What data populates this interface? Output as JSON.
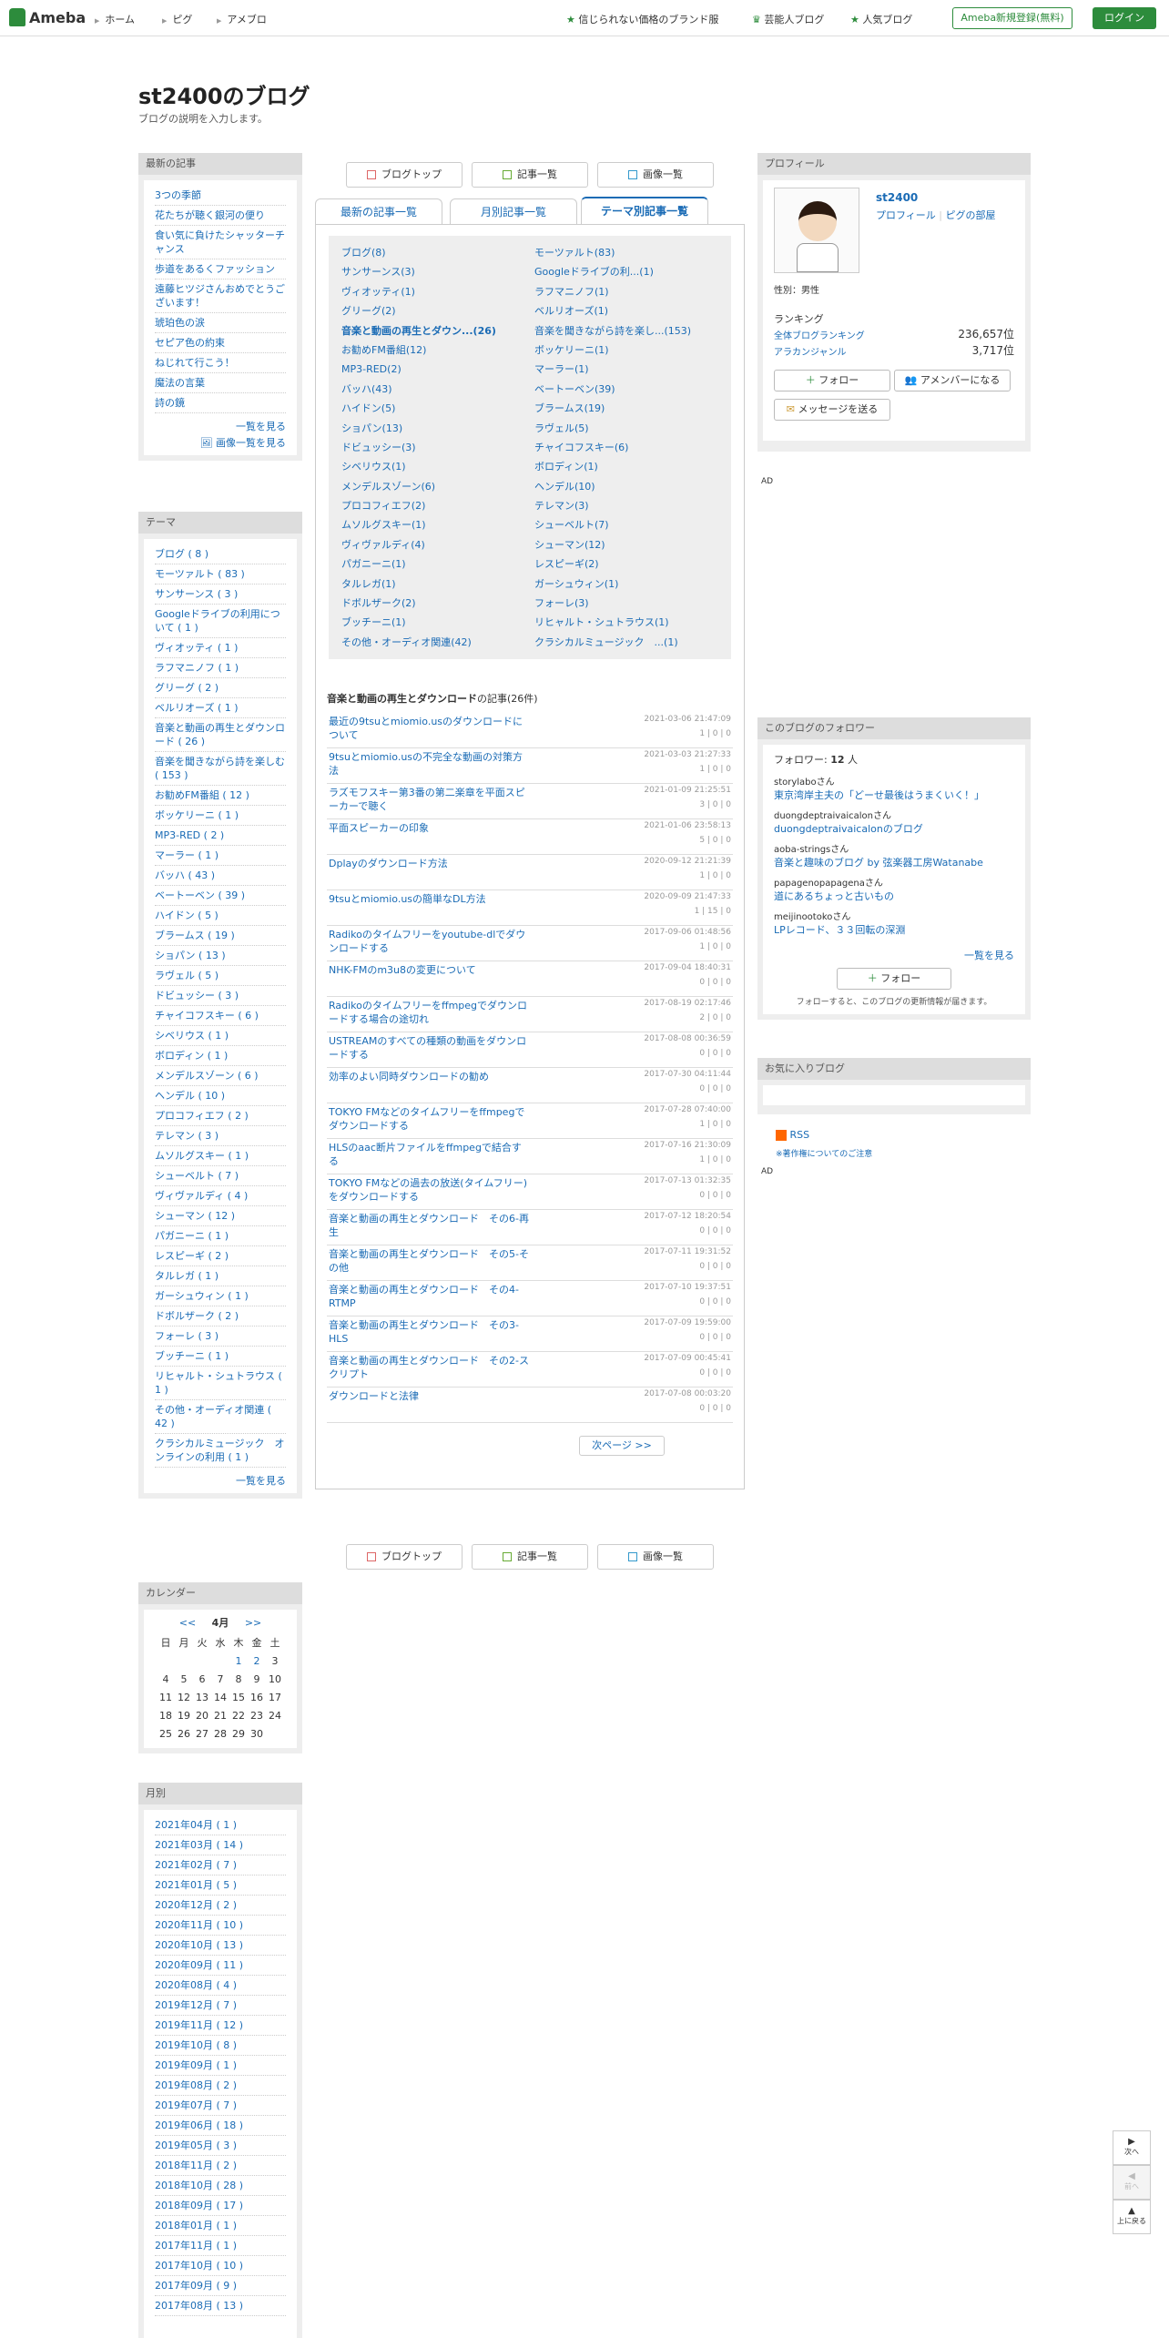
{
  "header": {
    "logo": "Ameba",
    "nav": [
      "ホーム",
      "ピグ",
      "アメブロ"
    ],
    "right_links": [
      "信じられない価格のブランド服",
      "芸能人ブログ",
      "人気ブログ"
    ],
    "register": "Ameba新規登録(無料)",
    "login": "ログイン"
  },
  "blog": {
    "title": "st2400のブログ",
    "description": "ブログの説明を入力します。"
  },
  "recent": {
    "heading": "最新の記事",
    "items": [
      "3つの季節",
      "花たちが聴く銀河の便り",
      "食い気に負けたシャッターチャンス",
      "歩道をあるくファッション",
      "遠藤ヒツジさんおめでとうございます！",
      "琥珀色の涙",
      "セピア色の約束",
      "ねじれて行こう！",
      "魔法の言葉",
      "詩の鏡"
    ],
    "more1": "一覧を見る",
    "more2": "画像一覧を見る"
  },
  "theme_side": {
    "heading": "テーマ",
    "items": [
      "ブログ ( 8 )",
      "モーツァルト ( 83 )",
      "サンサーンス ( 3 )",
      "Googleドライブの利用について ( 1 )",
      "ヴィオッティ ( 1 )",
      "ラフマニノフ ( 1 )",
      "グリーグ ( 2 )",
      "ベルリオーズ ( 1 )",
      "音楽と動画の再生とダウンロード ( 26 )",
      "音楽を聞きながら詩を楽しむ ( 153 )",
      "お勧めFM番組 ( 12 )",
      "ボッケリーニ ( 1 )",
      "MP3-RED ( 2 )",
      "マーラー ( 1 )",
      "バッハ ( 43 )",
      "ベートーベン ( 39 )",
      "ハイドン ( 5 )",
      "ブラームス ( 19 )",
      "ショパン ( 13 )",
      "ラヴェル ( 5 )",
      "ドビュッシー ( 3 )",
      "チャイコフスキー ( 6 )",
      "シベリウス ( 1 )",
      "ボロディン ( 1 )",
      "メンデルスゾーン ( 6 )",
      "ヘンデル ( 10 )",
      "プロコフィエフ ( 2 )",
      "テレマン ( 3 )",
      "ムソルグスキー ( 1 )",
      "シューベルト ( 7 )",
      "ヴィヴァルディ ( 4 )",
      "シューマン ( 12 )",
      "パガニーニ ( 1 )",
      "レスピーギ ( 2 )",
      "タルレガ ( 1 )",
      "ガーシュウィン ( 1 )",
      "ドボルザーク ( 2 )",
      "フォーレ ( 3 )",
      "ブッチーニ ( 1 )",
      "リヒャルト・シュトラウス ( 1 )",
      "その他・オーディオ関連 ( 42 )",
      "クラシカルミュージック　オンラインの利用 ( 1 )"
    ],
    "more": "一覧を見る"
  },
  "calendar": {
    "heading": "カレンダー",
    "prev": "<<",
    "month": "4月",
    "next": ">>",
    "weekdays": [
      "日",
      "月",
      "火",
      "水",
      "木",
      "金",
      "土"
    ],
    "weeks": [
      [
        "",
        "",
        "",
        "",
        "1",
        "2",
        "3"
      ],
      [
        "4",
        "5",
        "6",
        "7",
        "8",
        "9",
        "10"
      ],
      [
        "11",
        "12",
        "13",
        "14",
        "15",
        "16",
        "17"
      ],
      [
        "18",
        "19",
        "20",
        "21",
        "22",
        "23",
        "24"
      ],
      [
        "25",
        "26",
        "27",
        "28",
        "29",
        "30",
        ""
      ]
    ]
  },
  "monthly": {
    "heading": "月別",
    "items": [
      "2021年04月 ( 1 )",
      "2021年03月 ( 14 )",
      "2021年02月 ( 7 )",
      "2021年01月 ( 5 )",
      "2020年12月 ( 2 )",
      "2020年11月 ( 10 )",
      "2020年10月 ( 13 )",
      "2020年09月 ( 11 )",
      "2020年08月 ( 4 )",
      "2019年12月 ( 7 )",
      "2019年11月 ( 12 )",
      "2019年10月 ( 8 )",
      "2019年09月 ( 1 )",
      "2019年08月 ( 2 )",
      "2019年07月 ( 7 )",
      "2019年06月 ( 18 )",
      "2019年05月 ( 3 )",
      "2018年11月 ( 2 )",
      "2018年10月 ( 28 )",
      "2018年09月 ( 17 )",
      "2018年01月 ( 1 )",
      "2017年11月 ( 1 )",
      "2017年10月 ( 10 )",
      "2017年09月 ( 9 )",
      "2017年08月 ( 13 )"
    ]
  },
  "toptabs": [
    "ブログトップ",
    "記事一覧",
    "画像一覧"
  ],
  "tabs": [
    "最新の記事一覧",
    "月別記事一覧",
    "テーマ別記事一覧"
  ],
  "theme_grid": [
    "ブログ(8)",
    "モーツァルト(83)",
    "サンサーンス(3)",
    "Googleドライブの利...(1)",
    "ヴィオッティ(1)",
    "ラフマニノフ(1)",
    "グリーグ(2)",
    "ベルリオーズ(1)",
    "音楽と動画の再生とダウン...(26)",
    "音楽を聞きながら詩を楽し...(153)",
    "お勧めFM番組(12)",
    "ボッケリーニ(1)",
    "MP3-RED(2)",
    "マーラー(1)",
    "バッハ(43)",
    "ベートーベン(39)",
    "ハイドン(5)",
    "ブラームス(19)",
    "ショパン(13)",
    "ラヴェル(5)",
    "ドビュッシー(3)",
    "チャイコフスキー(6)",
    "シベリウス(1)",
    "ボロディン(1)",
    "メンデルスゾーン(6)",
    "ヘンデル(10)",
    "プロコフィエフ(2)",
    "テレマン(3)",
    "ムソルグスキー(1)",
    "シューベルト(7)",
    "ヴィヴァルディ(4)",
    "シューマン(12)",
    "パガニーニ(1)",
    "レスピーギ(2)",
    "タルレガ(1)",
    "ガーシュウィン(1)",
    "ドボルザーク(2)",
    "フォーレ(3)",
    "ブッチーニ(1)",
    "リヒャルト・シュトラウス(1)",
    "その他・オーディオ関連(42)",
    "クラシカルミュージック　...(1)"
  ],
  "entries_heading": {
    "theme": "音楽と動画の再生とダウンロード",
    "suffix": "の記事(26件)"
  },
  "entries": [
    {
      "title": "最近の9tsuとmiomio.usのダウンロードについて",
      "date": "2021-03-06 21:47:09",
      "meta": "1 | 0 | 0"
    },
    {
      "title": "9tsuとmiomio.usの不完全な動画の対策方法",
      "date": "2021-03-03 21:27:33",
      "meta": "1 | 0 | 0"
    },
    {
      "title": "ラズモフスキー第3番の第二楽章を平面スピーカーで聴く",
      "date": "2021-01-09 21:25:51",
      "meta": "3 | 0 | 0"
    },
    {
      "title": "平面スピーカーの印象",
      "date": "2021-01-06 23:58:13",
      "meta": "5 | 0 | 0"
    },
    {
      "title": "Dplayのダウンロード方法",
      "date": "2020-09-12 21:21:39",
      "meta": "1 | 0 | 0"
    },
    {
      "title": "9tsuとmiomio.usの簡単なDL方法",
      "date": "2020-09-09 21:47:33",
      "meta": "1 | 15 | 0"
    },
    {
      "title": "Radikoのタイムフリーをyoutube-dlでダウンロードする",
      "date": "2017-09-06 01:48:56",
      "meta": "1 | 0 | 0"
    },
    {
      "title": "NHK-FMのm3u8の変更について",
      "date": "2017-09-04 18:40:31",
      "meta": "0 | 0 | 0"
    },
    {
      "title": "Radikoのタイムフリーをffmpegでダウンロードする場合の途切れ",
      "date": "2017-08-19 02:17:46",
      "meta": "2 | 0 | 0"
    },
    {
      "title": "USTREAMのすべての種類の動画をダウンロードする",
      "date": "2017-08-08 00:36:59",
      "meta": "0 | 0 | 0"
    },
    {
      "title": "効率のよい同時ダウンロードの勧め",
      "date": "2017-07-30 04:11:44",
      "meta": "0 | 0 | 0"
    },
    {
      "title": "TOKYO FMなどのタイムフリーをffmpegでダウンロードする",
      "date": "2017-07-28 07:40:00",
      "meta": "1 | 0 | 0"
    },
    {
      "title": "HLSのaac断片ファイルをffmpegで結合する",
      "date": "2017-07-16 21:30:09",
      "meta": "1 | 0 | 0"
    },
    {
      "title": "TOKYO FMなどの過去の放送(タイムフリー)をダウンロードする",
      "date": "2017-07-13 01:32:35",
      "meta": "0 | 0 | 0"
    },
    {
      "title": "音楽と動画の再生とダウンロード　その6-再生",
      "date": "2017-07-12 18:20:54",
      "meta": "0 | 0 | 0"
    },
    {
      "title": "音楽と動画の再生とダウンロード　その5-その他",
      "date": "2017-07-11 19:31:52",
      "meta": "0 | 0 | 0"
    },
    {
      "title": "音楽と動画の再生とダウンロード　その4-RTMP",
      "date": "2017-07-10 19:37:51",
      "meta": "0 | 0 | 0"
    },
    {
      "title": "音楽と動画の再生とダウンロード　その3-HLS",
      "date": "2017-07-09 19:59:00",
      "meta": "0 | 0 | 0"
    },
    {
      "title": "音楽と動画の再生とダウンロード　その2-スクリプト",
      "date": "2017-07-09 00:45:41",
      "meta": "0 | 0 | 0"
    },
    {
      "title": "ダウンロードと法律",
      "date": "2017-07-08 00:03:20",
      "meta": "0 | 0 | 0"
    }
  ],
  "next_page": "次ページ >>",
  "profile": {
    "heading": "プロフィール",
    "name": "st2400",
    "link1": "プロフィール",
    "link2": "ピグの部屋",
    "gender": "性別：男性",
    "ranking_label": "ランキング",
    "rank1_label": "全体ブログランキング",
    "rank1_value": "236,657位",
    "rank2_label": "アラカンジャンル",
    "rank2_value": "3,717位",
    "follow": "フォロー",
    "member": "アメンバーになる",
    "message": "メッセージを送る"
  },
  "ad": "AD",
  "followers": {
    "heading": "このブログのフォロワー",
    "count_label": "フォロワー:",
    "count": "12",
    "count_unit": "人",
    "items": [
      {
        "user": "storylaboさん",
        "blog": "東京湾岸主夫の「どーせ最後はうまくいく！」"
      },
      {
        "user": "duongdeptraivaicalonさん",
        "blog": "duongdeptraivaicalonのブログ"
      },
      {
        "user": "aoba-stringsさん",
        "blog": "音楽と趣味のブログ by 弦楽器工房Watanabe"
      },
      {
        "user": "papagenopapagenaさん",
        "blog": "道にあるちょっと古いもの"
      },
      {
        "user": "meijinootokoさん",
        "blog": "LPレコード、３３回転の深淵"
      }
    ],
    "more": "一覧を見る",
    "follow": "フォロー",
    "note": "フォローすると、このブログの更新情報が届きます。"
  },
  "favorites": {
    "heading": "お気に入りブログ"
  },
  "rss": {
    "label": "RSS",
    "note": "※著作権についてのご注意"
  },
  "side_buttons": [
    "次へ",
    "前へ",
    "上に戻る"
  ]
}
